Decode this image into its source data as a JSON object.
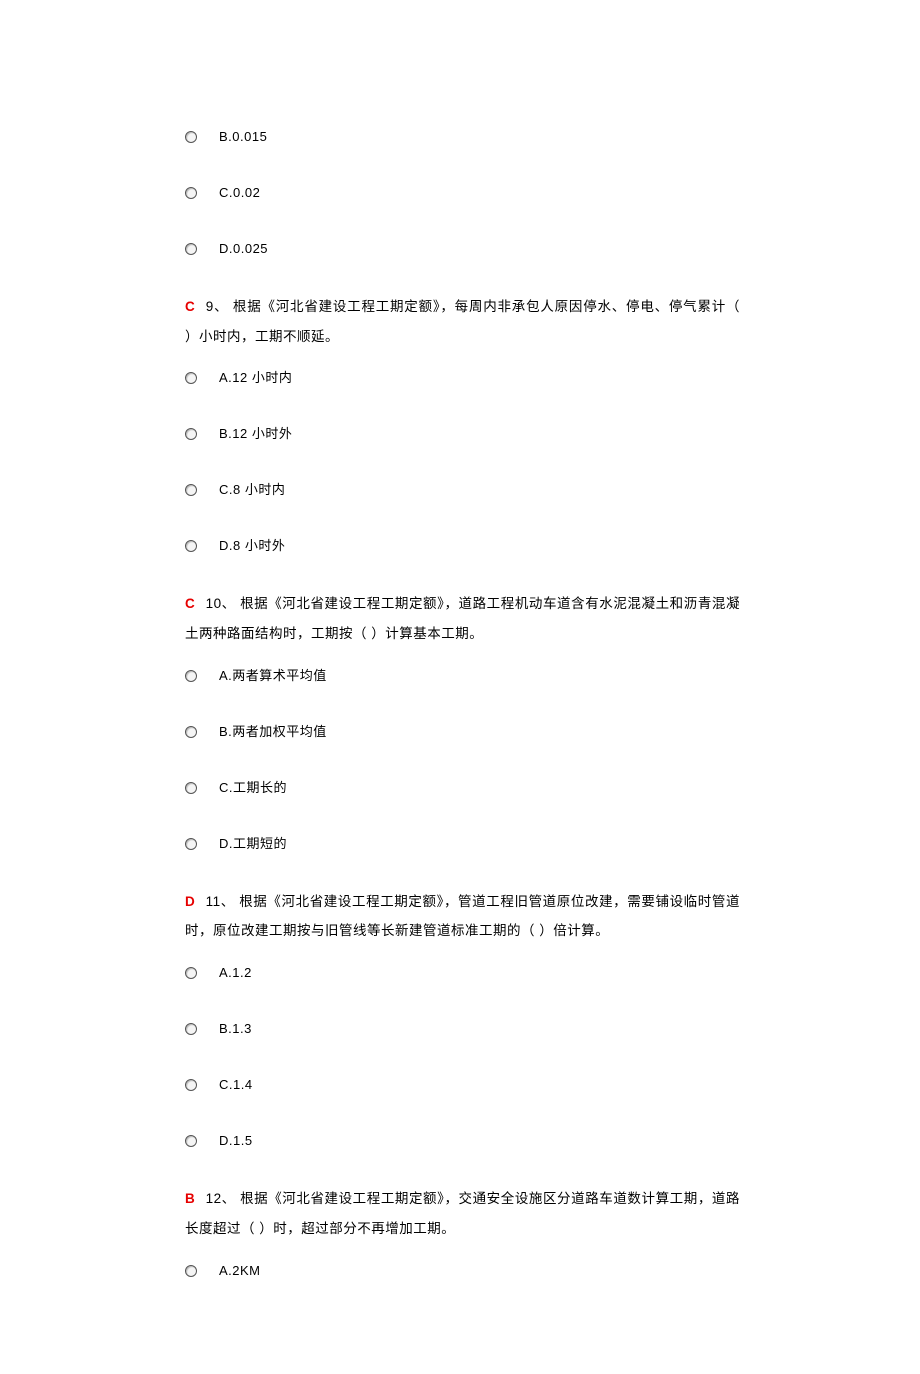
{
  "q8_tail_options": [
    {
      "label": "B.0.015"
    },
    {
      "label": "C.0.02"
    },
    {
      "label": "D.0.025"
    }
  ],
  "questions": [
    {
      "answer": "C",
      "num": "9、",
      "stem": " 根据《河北省建设工程工期定额》，每周内非承包人原因停水、停电、停气累计（ ）小时内，工期不顺延。",
      "options": [
        {
          "label": "A.12 小时内"
        },
        {
          "label": "B.12 小时外"
        },
        {
          "label": "C.8 小时内"
        },
        {
          "label": "D.8 小时外"
        }
      ]
    },
    {
      "answer": "C",
      "num": "10、",
      "stem": " 根据《河北省建设工程工期定额》，道路工程机动车道含有水泥混凝土和沥青混凝土两种路面结构时，工期按（ ）计算基本工期。",
      "options": [
        {
          "label": "A.两者算术平均值"
        },
        {
          "label": "B.两者加权平均值"
        },
        {
          "label": "C.工期长的"
        },
        {
          "label": "D.工期短的"
        }
      ]
    },
    {
      "answer": "D",
      "num": "11、",
      "stem": " 根据《河北省建设工程工期定额》，管道工程旧管道原位改建，需要铺设临时管道时，原位改建工期按与旧管线等长新建管道标准工期的（ ）倍计算。",
      "options": [
        {
          "label": "A.1.2"
        },
        {
          "label": "B.1.3"
        },
        {
          "label": "C.1.4"
        },
        {
          "label": "D.1.5"
        }
      ]
    },
    {
      "answer": "B",
      "num": "12、",
      "stem": " 根据《河北省建设工程工期定额》，交通安全设施区分道路车道数计算工期，道路长度超过（ ）时，超过部分不再增加工期。",
      "options": [
        {
          "label": "A.2KM"
        }
      ]
    }
  ]
}
